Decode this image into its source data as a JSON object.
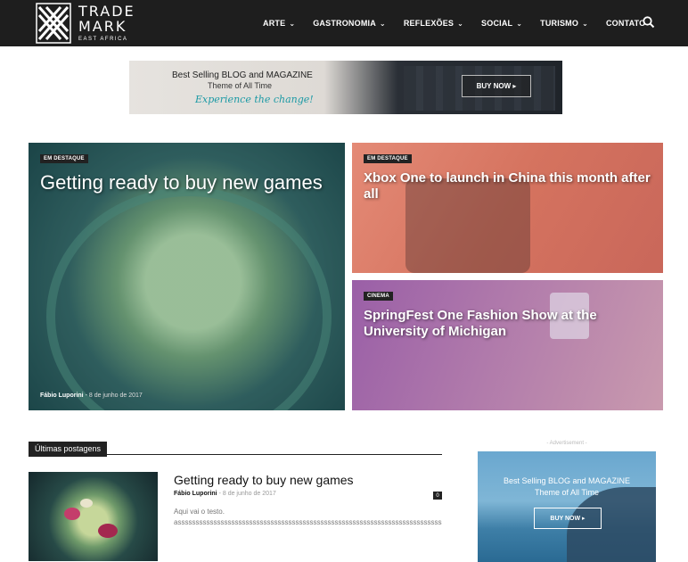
{
  "header": {
    "logo": {
      "line1": "TRADE",
      "line2": "MARK",
      "line3": "EAST AFRICA"
    },
    "nav": [
      {
        "label": "ARTE",
        "dropdown": true
      },
      {
        "label": "GASTRONOMIA",
        "dropdown": true
      },
      {
        "label": "REFLEXÕES",
        "dropdown": true
      },
      {
        "label": "SOCIAL",
        "dropdown": true
      },
      {
        "label": "TURISMO",
        "dropdown": true
      },
      {
        "label": "CONTATO",
        "dropdown": false
      }
    ],
    "search_icon": "search-icon",
    "chevron": "⌄"
  },
  "top_banner": {
    "line1": "Best Selling BLOG and MAGAZINE",
    "line2": "Theme of All Time",
    "line3": "Experience the change!",
    "button": "BUY NOW ▸"
  },
  "featured": [
    {
      "badge": "EM DESTAQUE",
      "title": "Getting ready to buy new games",
      "author": "Fábio Luporini",
      "separator": "-",
      "date": "8 de junho de 2017"
    },
    {
      "badge": "EM DESTAQUE",
      "title": "Xbox One to launch in China this month after all"
    },
    {
      "badge": "CINEMA",
      "title": "SpringFest One Fashion Show at the University of Michigan"
    }
  ],
  "latest": {
    "block_title": "Últimas postagens",
    "post": {
      "title": "Getting ready to buy new games",
      "author": "Fábio Luporini",
      "separator": "-",
      "date": "8 de junho de 2017",
      "comments": "0",
      "excerpt_line1": "Aqui vai o testo.",
      "excerpt_line2": "asssssssssssssssssssssssssssssssssssssssssssssssssssssssssssssssssssssssssssssss"
    }
  },
  "sidebar_ad": {
    "label": "- Advertisement -",
    "line1": "Best Selling BLOG and MAGAZINE",
    "line2": "Theme of All Time",
    "button": "BUY NOW ▸"
  },
  "colors": {
    "header_bg": "#1e1e1e",
    "accent_dark": "#222222",
    "banner_accent": "#1c9aa5"
  }
}
